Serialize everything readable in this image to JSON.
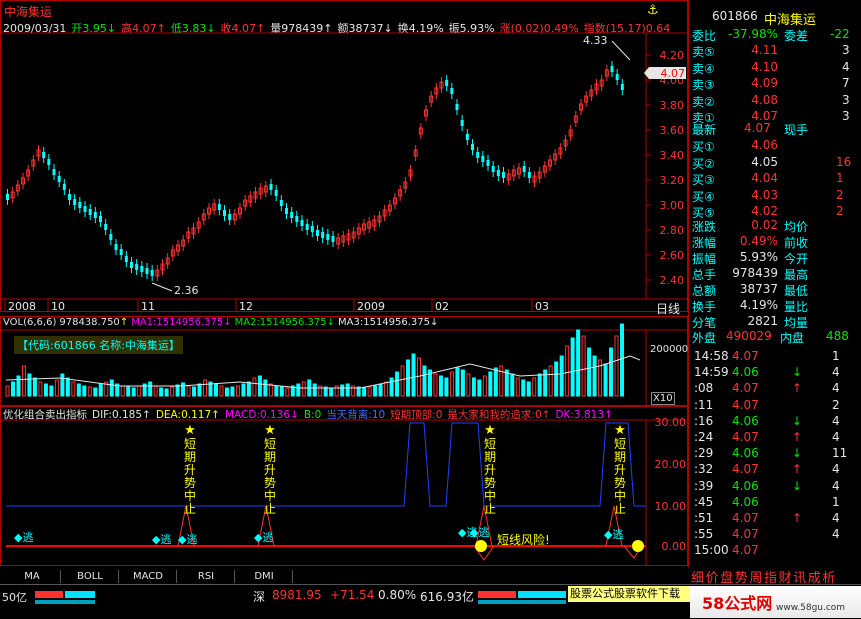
{
  "header": {
    "stock_name": "中海集运",
    "quote_line": [
      {
        "t": "2009/03/31",
        "c": "#e6e6e6"
      },
      {
        "t": "开3.95",
        "c": "#00e600"
      },
      {
        "t": "↓",
        "c": "#00e600"
      },
      {
        "t": "高4.07",
        "c": "#ff3232"
      },
      {
        "t": "↑",
        "c": "#ff3232"
      },
      {
        "t": "低3.83",
        "c": "#00e600"
      },
      {
        "t": "↓",
        "c": "#00e600"
      },
      {
        "t": "收4.07",
        "c": "#ff3232"
      },
      {
        "t": "↑",
        "c": "#ff3232"
      },
      {
        "t": "量978439",
        "c": "#e6e6e6"
      },
      {
        "t": "↑",
        "c": "#e6e6e6"
      },
      {
        "t": "额38737",
        "c": "#e6e6e6"
      },
      {
        "t": "↓",
        "c": "#e6e6e6"
      },
      {
        "t": "换4.19%",
        "c": "#e6e6e6"
      },
      {
        "t": "振5.93%",
        "c": "#e6e6e6"
      },
      {
        "t": "涨(0.02)0.49%",
        "c": "#ff3232"
      },
      {
        "t": "指数(15.17)0.64",
        "c": "#ff3232"
      }
    ],
    "anchor_icon": "anchor-icon"
  },
  "kline": {
    "high_label": "4.33",
    "low_label": "2.36",
    "current_price_tag": "4.07",
    "price_axis": [
      "4.20",
      "4.00",
      "3.80",
      "3.60",
      "3.40",
      "3.20",
      "3.00",
      "2.80",
      "2.60",
      "2.40"
    ],
    "date_axis": [
      "2008",
      "10",
      "11",
      "12",
      "2009",
      "02",
      "03"
    ],
    "period_label": "日线"
  },
  "volume": {
    "title_line": [
      {
        "t": "VOL(6,6,6)",
        "c": "#e6e6e6"
      },
      {
        "t": "978438.750",
        "c": "#e6e6e6"
      },
      {
        "t": "↑",
        "c": "#ffff00"
      },
      {
        "t": "MA1:1514956.375",
        "c": "#ff00ff"
      },
      {
        "t": "↓",
        "c": "#ff00ff"
      },
      {
        "t": "MA2:1514956.375",
        "c": "#00e600"
      },
      {
        "t": "↓",
        "c": "#00e600"
      },
      {
        "t": "MA3:1514956.375",
        "c": "#e6e6e6"
      },
      {
        "t": "↓",
        "c": "#e6e6e6"
      }
    ],
    "code_box": "【代码:601866 名称:中海集运】",
    "axis_value": "200000",
    "unit": "X10"
  },
  "indicator": {
    "title_line": [
      {
        "t": "优化组合卖出指标",
        "c": "#e6e6e6"
      },
      {
        "t": "DIF:0.185",
        "c": "#e6e6e6"
      },
      {
        "t": "↑",
        "c": "#e6e6e6"
      },
      {
        "t": "DEA:0.117",
        "c": "#ffff00"
      },
      {
        "t": "↑",
        "c": "#ffff00"
      },
      {
        "t": "MACD:0.136",
        "c": "#ff00ff"
      },
      {
        "t": "↓",
        "c": "#ff00ff"
      },
      {
        "t": "B:0",
        "c": "#00e600"
      },
      {
        "t": "当天背离:10",
        "c": "#4a6cff"
      },
      {
        "t": "短期顶部:0",
        "c": "#ff3232"
      },
      {
        "t": "是大家和我的追求:0",
        "c": "#ff3232"
      },
      {
        "t": "↑",
        "c": "#ff3232"
      },
      {
        "t": "DK:3.813",
        "c": "#ff00ff"
      },
      {
        "t": "↑",
        "c": "#ff00ff"
      }
    ],
    "axis": [
      "30.00",
      "20.00",
      "10.00",
      "0.00"
    ],
    "signal_text": "短期升势中止",
    "escape_label": "逃",
    "risk_label": "短线风险!"
  },
  "bottom_tabs": [
    "MA",
    "BOLL",
    "MACD",
    "RSI",
    "DMI"
  ],
  "right_panel": {
    "code": "601866",
    "name": "中海集运",
    "weibi_label": "委比",
    "weibi_value": "-37.98%",
    "weicha_label": "委差",
    "weicha_value": "-22",
    "sells": [
      {
        "label": "卖⑤",
        "price": "4.11",
        "vol": "3"
      },
      {
        "label": "卖④",
        "price": "4.10",
        "vol": "4"
      },
      {
        "label": "卖③",
        "price": "4.09",
        "vol": "7"
      },
      {
        "label": "卖②",
        "price": "4.08",
        "vol": "3"
      },
      {
        "label": "卖①",
        "price": "4.07",
        "vol": "3"
      }
    ],
    "latest_label": "最新",
    "latest_price": "4.07",
    "latest_right": "现手",
    "buys": [
      {
        "label": "买①",
        "price": "4.06",
        "vol": ""
      },
      {
        "label": "买②",
        "price": "4.05",
        "vol": "16"
      },
      {
        "label": "买③",
        "price": "4.04",
        "vol": "1"
      },
      {
        "label": "买④",
        "price": "4.03",
        "vol": "2"
      },
      {
        "label": "买⑤",
        "price": "4.02",
        "vol": "2"
      }
    ],
    "stats": [
      {
        "l": "涨跌",
        "v": "0.02",
        "r": "均价"
      },
      {
        "l": "涨幅",
        "v": "0.49%",
        "r": "前收"
      },
      {
        "l": "振幅",
        "v": "5.93%",
        "r": "今开"
      },
      {
        "l": "总手",
        "v": "978439",
        "r": "最高"
      },
      {
        "l": "总额",
        "v": "38737",
        "r": "最低"
      },
      {
        "l": "换手",
        "v": "4.19%",
        "r": "量比"
      },
      {
        "l": "分笔",
        "v": "2821",
        "r": "均量"
      }
    ],
    "waipan_label": "外盘",
    "waipan_value": "490029",
    "neipan_label": "内盘",
    "neipan_value": "488",
    "ticks": [
      {
        "t": "14:58",
        "p": "4.07",
        "a": "",
        "v": "1"
      },
      {
        "t": "14:59",
        "p": "4.06",
        "a": "↓",
        "v": "4"
      },
      {
        "t": ":08",
        "p": "4.07",
        "a": "↑",
        "v": "4"
      },
      {
        "t": ":11",
        "p": "4.07",
        "a": "",
        "v": "2"
      },
      {
        "t": ":16",
        "p": "4.06",
        "a": "↓",
        "v": "4"
      },
      {
        "t": ":24",
        "p": "4.07",
        "a": "↑",
        "v": "4"
      },
      {
        "t": ":29",
        "p": "4.06",
        "a": "↓",
        "v": "11"
      },
      {
        "t": ":32",
        "p": "4.07",
        "a": "↑",
        "v": "4"
      },
      {
        "t": ":39",
        "p": "4.06",
        "a": "↓",
        "v": "4"
      },
      {
        "t": ":45",
        "p": "4.06",
        "a": "",
        "v": "1"
      },
      {
        "t": ":51",
        "p": "4.07",
        "a": "↑",
        "v": "4"
      },
      {
        "t": ":55",
        "p": "4.07",
        "a": "",
        "v": "4"
      },
      {
        "t": "15:00",
        "p": "4.07",
        "a": "",
        "v": ""
      }
    ],
    "tabs": "细价盘势周指财讯成析"
  },
  "status_bar": {
    "left_value": "50亿",
    "market": "深",
    "index_value": "8981.95",
    "index_change": "+71.54",
    "index_pct": "0.80%",
    "turnover": "616.93亿",
    "ad_text": "股票公式股票软件下载",
    "watermark": "58公式网",
    "watermark_url": "www.58gu.com"
  },
  "colors": {
    "up": "#ff3232",
    "down": "#00e600",
    "frame": "#b00000",
    "cyan": "#00ffff"
  }
}
